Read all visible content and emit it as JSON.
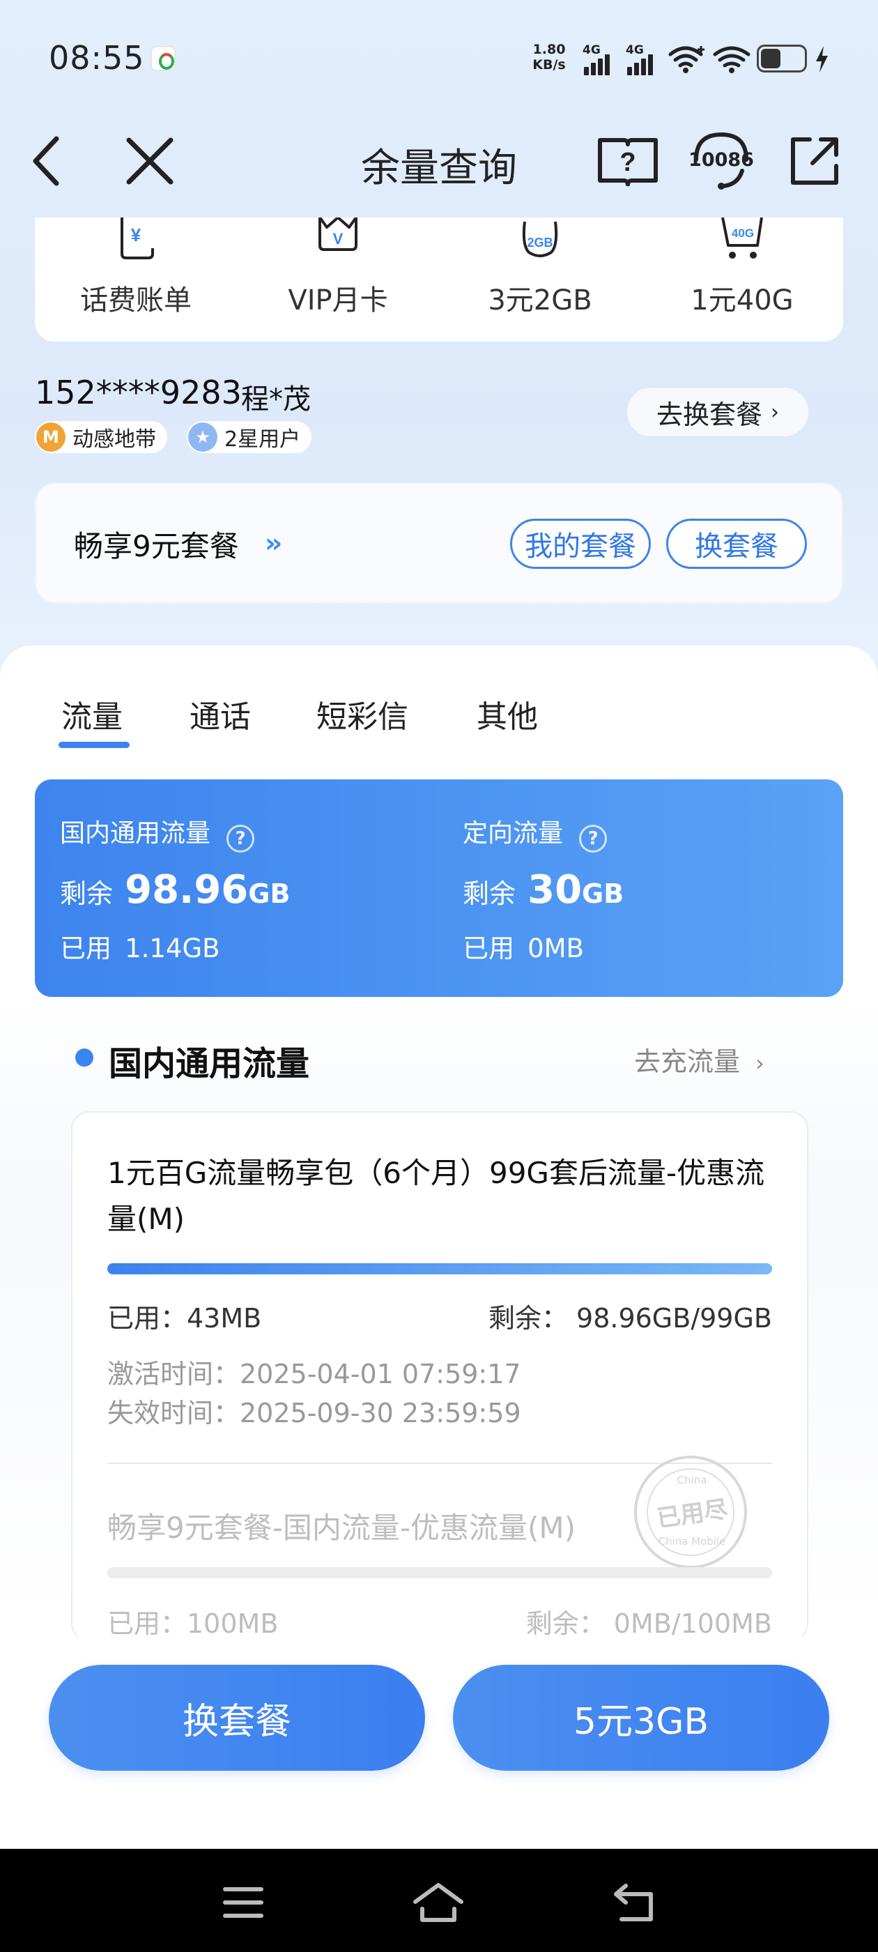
{
  "status_bar": {
    "time": "08:55",
    "net_speed_value": "1.80",
    "net_speed_unit": "KB/s",
    "signal_1_label": "4G",
    "signal_2_label": "4G",
    "icons": [
      "sim-carrier-icon",
      "signal-4g-icon",
      "signal-4g-icon",
      "wifi-icon",
      "wifi-icon",
      "battery-icon",
      "charging-icon"
    ]
  },
  "header": {
    "title": "余量查询",
    "help_icon": "book-question-icon",
    "service_number": "10086",
    "share_icon": "share-icon"
  },
  "shortcuts": [
    {
      "label": "话费账单",
      "icon": "bill-icon",
      "icon_text": "¥"
    },
    {
      "label": "VIP月卡",
      "icon": "vip-crown-icon",
      "icon_text": "V"
    },
    {
      "label": "3元2GB",
      "icon": "data-pack-icon",
      "icon_text": "2GB"
    },
    {
      "label": "1元40G",
      "icon": "cart-icon",
      "icon_text": "40G"
    }
  ],
  "account": {
    "phone": "152****9283",
    "name": "程*茂",
    "brand_badge_icon": "M",
    "brand_badge": "动感地带",
    "level_badge": "2星用户",
    "change_plan_link": "去换套餐"
  },
  "plan": {
    "name": "畅享9元套餐",
    "my_plan_button": "我的套餐",
    "change_plan_button": "换套餐"
  },
  "tabs": [
    {
      "label": "流量",
      "active": true
    },
    {
      "label": "通话",
      "active": false
    },
    {
      "label": "短彩信",
      "active": false
    },
    {
      "label": "其他",
      "active": false
    }
  ],
  "summary": {
    "general": {
      "title": "国内通用流量",
      "remain_label": "剩余",
      "remain_value": "98.96",
      "remain_unit": "GB",
      "used_label": "已用",
      "used_value": "1.14GB"
    },
    "directed": {
      "title": "定向流量",
      "remain_label": "剩余",
      "remain_value": "30",
      "remain_unit": "GB",
      "used_label": "已用",
      "used_value": "0MB"
    },
    "help_glyph": "?"
  },
  "section": {
    "title": "国内通用流量",
    "recharge_link": "去充流量"
  },
  "packages": [
    {
      "name": "1元百G流量畅享包（6个月）99G套后流量-优惠流量(M)",
      "used": "已用：43MB",
      "remain": "剩余：  98.96GB/99GB",
      "used_fraction": 0.0004,
      "activated": "激活时间：2025-04-01 07:59:17",
      "expires": "失效时间：2025-09-30 23:59:59"
    },
    {
      "name": "畅享9元套餐-国内流量-优惠流量(M)",
      "used": "已用：100MB",
      "remain": "剩余：  0MB/100MB",
      "used_fraction": 1.0,
      "stamp": "已用尽",
      "stamp_sub": "China Mobile",
      "stamp_top": "China"
    }
  ],
  "bottom_actions": {
    "change_plan": "换套餐",
    "buy_pack": "5元3GB"
  },
  "nav": {
    "icons": [
      "menu-icon",
      "home-icon",
      "back-icon"
    ]
  },
  "colors": {
    "accent": "#3a85ef",
    "card_gradient_start": "#3d84ee",
    "card_gradient_end": "#5aa2f6"
  }
}
